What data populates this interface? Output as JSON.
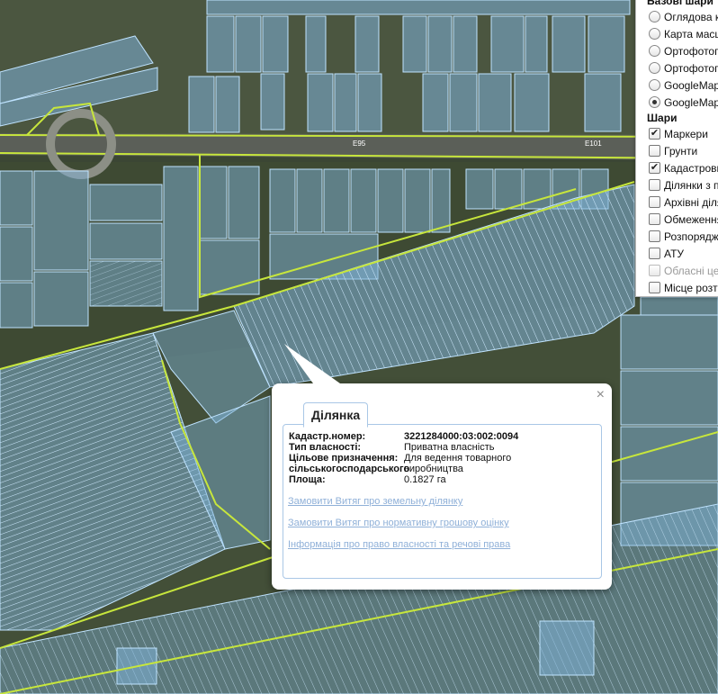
{
  "map": {
    "road_labels": [
      "E95",
      "E101"
    ],
    "colors": {
      "parcel_fill": "#7fb3d9",
      "parcel_stroke": "#bfe3ff",
      "boundary_line": "#c7e63c",
      "field_dark": "#2f3a2a",
      "field_green": "#46563a"
    }
  },
  "layers_panel": {
    "base_heading": "Базові шари",
    "base_items": [
      {
        "label": "Оглядова к",
        "checked": false
      },
      {
        "label": "Карта масш",
        "checked": false
      },
      {
        "label": "Ортофотоп",
        "checked": false
      },
      {
        "label": "Ортофотоп",
        "checked": false
      },
      {
        "label": "GoogleMap",
        "checked": false
      },
      {
        "label": "GoogleMap",
        "checked": true
      }
    ],
    "overlay_heading": "Шари",
    "overlay_items": [
      {
        "label": "Маркери",
        "checked": true,
        "disabled": false
      },
      {
        "label": "Грунти",
        "checked": false,
        "disabled": false
      },
      {
        "label": "Кадастрови",
        "checked": true,
        "disabled": false
      },
      {
        "label": "Ділянки з п",
        "checked": false,
        "disabled": false
      },
      {
        "label": "Архівні діля",
        "checked": false,
        "disabled": false
      },
      {
        "label": "Обмеження",
        "checked": false,
        "disabled": false
      },
      {
        "label": "Розпорядже",
        "checked": false,
        "disabled": false
      },
      {
        "label": "АТУ",
        "checked": false,
        "disabled": false
      },
      {
        "label": "Обласні цен",
        "checked": false,
        "disabled": true
      },
      {
        "label": "Місце розта",
        "checked": false,
        "disabled": false
      }
    ]
  },
  "popup": {
    "tab_label": "Ділянка",
    "close_symbol": "×",
    "fields": {
      "cadastral_key": "Кадастр.номер:",
      "cadastral_value": "3221284000:03:002:0094",
      "ownership_key": "Тип власності:",
      "ownership_value": "Приватна власність",
      "purpose_key_1": "Цільове призначення:",
      "purpose_value_1": "Для ведення товарного",
      "purpose_key_2": "сільськогосподарського",
      "purpose_value_2": "виробництва",
      "area_key": "Площа:",
      "area_value": "0.1827 га"
    },
    "links": {
      "extract_land": "Замовити Витяг про земельну ділянку",
      "extract_valuation": "Замовити Витяг про нормативну грошову оцінку",
      "ownership_info": "Інформація про право власності та речові права"
    }
  }
}
